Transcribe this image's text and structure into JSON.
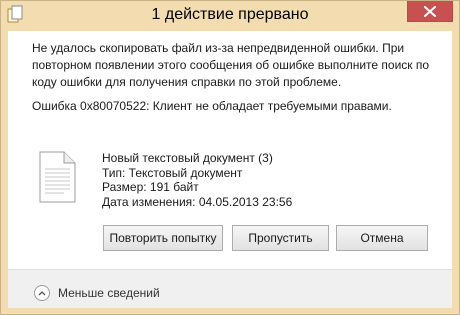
{
  "window": {
    "title": "1 действие прервано"
  },
  "message": {
    "text": "Не удалось скопировать файл из-за непредвиденной ошибки. При повторном появлении этого сообщения об ошибке выполните поиск по коду ошибки для получения справки по этой проблеме.",
    "error": "Ошибка 0x80070522: Клиент не обладает требуемыми правами."
  },
  "file": {
    "icon": "document-icon",
    "name": "Новый текстовый документ (3)",
    "type": "Тип: Текстовый документ",
    "size": "Размер: 191 байт",
    "modified": "Дата изменения: 04.05.2013 23:56"
  },
  "buttons": {
    "retry": "Повторить попытку",
    "skip": "Пропустить",
    "cancel": "Отмена"
  },
  "footer": {
    "toggle_label": "Меньше сведений",
    "toggle_icon": "chevron-up-icon"
  },
  "colors": {
    "frame": "#f3dcaf",
    "close_button": "#c75050"
  }
}
